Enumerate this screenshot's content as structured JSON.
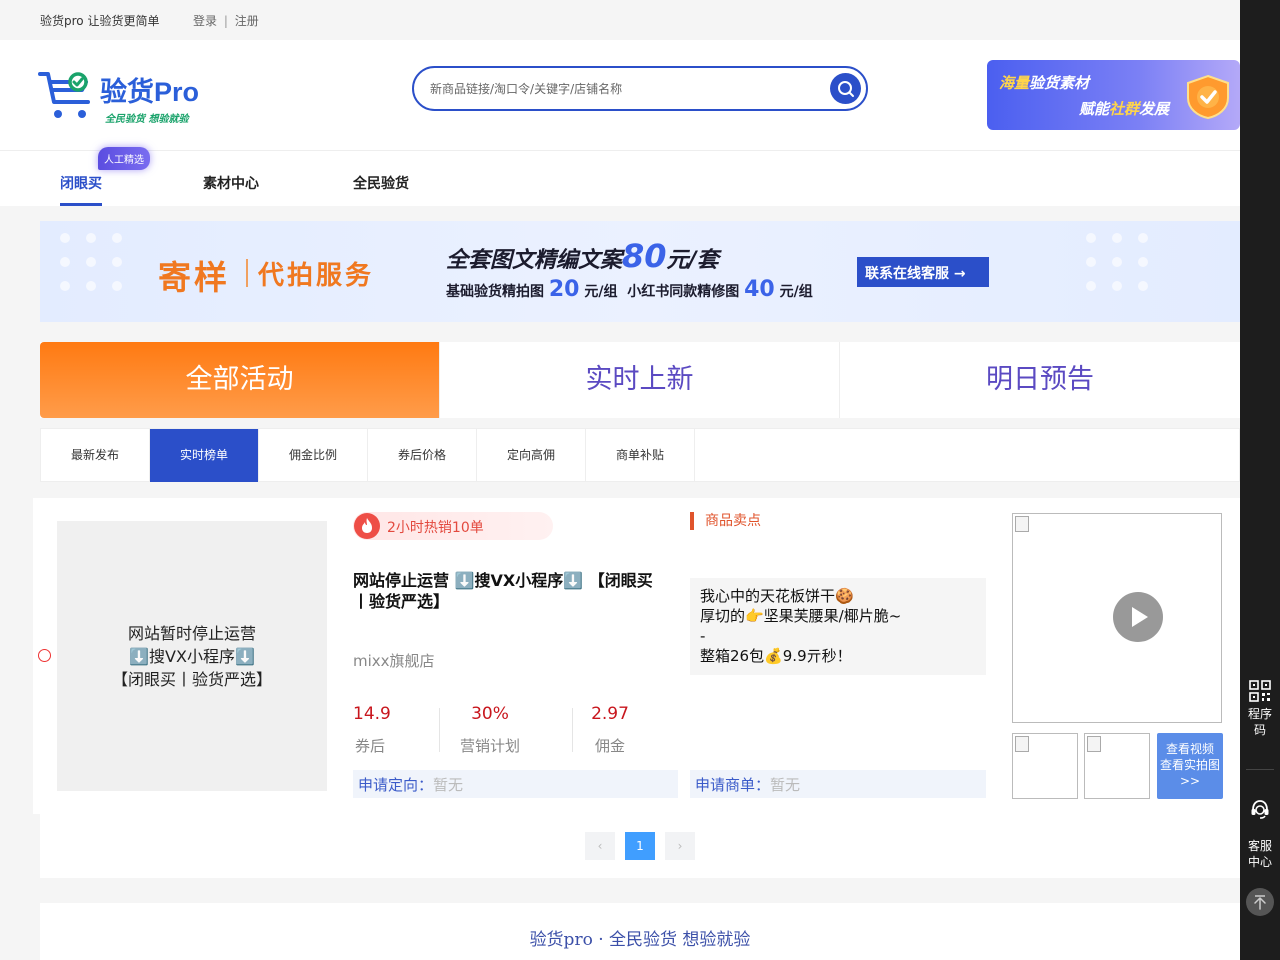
{
  "topbar": {
    "slogan": "验货pro 让验货更简单",
    "login": "登录",
    "divider": "|",
    "register": "注册"
  },
  "logo": {
    "brand": "验货Pro",
    "tagline": "全民验货 想验就验",
    "icon": "cart-check-icon"
  },
  "search": {
    "placeholder": "新商品链接/淘口令/关键字/店铺名称",
    "value": "",
    "icon": "search-icon"
  },
  "promo": {
    "line1_a": "海量",
    "line1_b": "验货素材",
    "line2_a": "赋能",
    "line2_b": "社群",
    "line2_c": "发展",
    "icon": "shield-check-icon"
  },
  "nav": {
    "items": [
      {
        "label": "闭眼买",
        "active": true
      },
      {
        "label": "素材中心",
        "active": false
      },
      {
        "label": "全民验货",
        "active": false
      }
    ],
    "badge": "人工精选"
  },
  "banner": {
    "title_a": "寄样",
    "title_b": "代拍服务",
    "headline_pre": "全套图文精编文案",
    "headline_num": "80",
    "headline_post": "元/套",
    "sub_1": "基础验货精拍图",
    "sub_1_num": "20",
    "sub_1_unit": "元/组",
    "sub_2": "小红书同款精修图",
    "sub_2_num": "40",
    "sub_2_unit": "元/组",
    "cta": "联系在线客服 →"
  },
  "big_tabs": [
    {
      "label": "全部活动",
      "active": true
    },
    {
      "label": "实时上新",
      "active": false
    },
    {
      "label": "明日预告",
      "active": false
    }
  ],
  "filters": [
    {
      "label": "最新发布",
      "active": false
    },
    {
      "label": "实时榜单",
      "active": true
    },
    {
      "label": "佣金比例",
      "active": false
    },
    {
      "label": "券后价格",
      "active": false
    },
    {
      "label": "定向高佣",
      "active": false
    },
    {
      "label": "商单补贴",
      "active": false
    }
  ],
  "product": {
    "image_text": [
      "网站暂时停止运营",
      "⬇️搜VX小程序⬇️",
      "【闭眼买丨验货严选】"
    ],
    "hot": "2小时热销10单",
    "title": "网站停止运营 ⬇️搜VX小程序⬇️ 【闭眼买丨验货严选】",
    "shop": "mixx旗舰店",
    "stats": [
      {
        "value": "14.9",
        "label": "券后"
      },
      {
        "value": "30%",
        "label": "营销计划"
      },
      {
        "value": "2.97",
        "label": "佣金"
      }
    ],
    "apply_direct": {
      "label": "申请定向：",
      "value": "暂无"
    },
    "apply_order": {
      "label": "申请商单：",
      "value": "暂无"
    },
    "selling_header": "商品卖点",
    "selling_lines": [
      "我心中的天花板饼干🍪",
      "厚切的👉坚果芙腰果/椰片脆~",
      "-",
      "整箱26包💰9.9亓秒！"
    ],
    "view_button": [
      "查看视频",
      "查看实拍图",
      ">>"
    ]
  },
  "pagination": {
    "prev": "‹",
    "current": "1",
    "next": "›"
  },
  "footer": {
    "text": "验货pro · 全民验货 想验就验"
  },
  "right_sidebar": {
    "miniprogram": "程序码",
    "service": "客服中心",
    "icons": [
      "qrcode-icon",
      "headset-icon",
      "arrow-up-icon"
    ]
  },
  "colors": {
    "primary": "#2b4fc9",
    "orange": "#ff7a12",
    "price_red": "#c8161d"
  }
}
